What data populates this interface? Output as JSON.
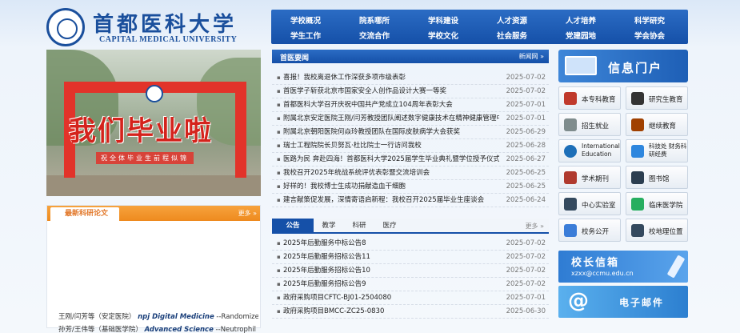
{
  "header": {
    "logo_cn": "首都医科大学",
    "logo_en": "CAPITAL MEDICAL UNIVERSITY"
  },
  "nav": {
    "row1": [
      "学校概况",
      "院系哪所",
      "学科建设",
      "人才资源",
      "人才培养",
      "科学研究"
    ],
    "row2": [
      "学生工作",
      "交流合作",
      "学校文化",
      "社会服务",
      "党建园地",
      "学会协会"
    ]
  },
  "hero": {
    "banner": "我们毕业啦",
    "subtitle": "祝全体毕业生前程似锦"
  },
  "papers": {
    "tab": "最新科研论文",
    "more": "更多 »",
    "items": [
      {
        "authors": "王刚/闫芳等（安定医院）",
        "journal": "npj Digital Medicine",
        "title": " --Randomized"
      },
      {
        "authors": "孙芳/王伟等（基础医学院）",
        "journal": "Advanced Science",
        "title": " --Neutrophil"
      }
    ]
  },
  "news": {
    "title": "首医要闻",
    "more": "新闻网 »",
    "items": [
      {
        "text": "喜报！我校离退休工作深获多项市级表彰",
        "date": "2025-07-02"
      },
      {
        "text": "首医学子斩获北京市国家安全人创作品设计大赛一等奖",
        "date": "2025-07-02"
      },
      {
        "text": "首都医科大学召开庆祝中国共产党成立104周年表彰大会",
        "date": "2025-07-01"
      },
      {
        "text": "附属北京安定医院王刚/闫芳教授团队阐述数字健康技术在精神健康管理中的应",
        "date": "2025-07-01"
      },
      {
        "text": "附属北京朝阳医院何焱玲教授团队在国际皮肤病学大会获奖",
        "date": "2025-06-29"
      },
      {
        "text": "瑞士工程院院长贝努瓦·杜比院士一行访问我校",
        "date": "2025-06-28"
      },
      {
        "text": "医路为民 奔赴四海！首都医科大学2025届学生毕业典礼暨学位授予仪式举行",
        "date": "2025-06-27"
      },
      {
        "text": "我校召开2025年统战系统评优表彰暨交流培训会",
        "date": "2025-06-25"
      },
      {
        "text": "好样的！我校博士生成功捐献造血干细胞",
        "date": "2025-06-25"
      },
      {
        "text": "建言献策促发展，深情寄语启新程：我校召开2025届毕业生座谈会",
        "date": "2025-06-24"
      }
    ]
  },
  "notices": {
    "tabs": [
      "公告",
      "教学",
      "科研",
      "医疗"
    ],
    "active_tab": "公告",
    "more": "更多 »",
    "items": [
      {
        "text": "2025年后勤服务中标公告8",
        "date": "2025-07-02"
      },
      {
        "text": "2025年后勤服务招标公告11",
        "date": "2025-07-02"
      },
      {
        "text": "2025年后勤服务招标公告10",
        "date": "2025-07-02"
      },
      {
        "text": "2025年后勤服务招标公告9",
        "date": "2025-07-02"
      },
      {
        "text": "政府采购项目CFTC-BJ01-2504080",
        "date": "2025-07-01"
      },
      {
        "text": "政府采购项目BMCC-ZC25-0830",
        "date": "2025-06-30"
      }
    ]
  },
  "portal": {
    "label": "信息门户"
  },
  "quick_links": [
    {
      "label": "本专科教育",
      "icon": "book-icon",
      "color": "#c0392b"
    },
    {
      "label": "研究生教育",
      "icon": "graduation-cap-icon",
      "color": "#333333"
    },
    {
      "label": "招生就业",
      "icon": "handshake-icon",
      "color": "#7f8c8d"
    },
    {
      "label": "继续教育",
      "icon": "books-icon",
      "color": "#a04000"
    },
    {
      "label": "International Education",
      "icon": "globe-icon",
      "color": "#1e6fb8"
    },
    {
      "label": "科技处 财务科研经费",
      "icon": "finance-icon",
      "color": "#2e86de"
    },
    {
      "label": "学术期刊",
      "icon": "journal-icon",
      "color": "#b03a2e"
    },
    {
      "label": "图书馆",
      "icon": "library-icon",
      "color": "#2c3e50"
    },
    {
      "label": "中心实验室",
      "icon": "microscope-icon",
      "color": "#34495e"
    },
    {
      "label": "临床医学院",
      "icon": "medical-icon",
      "color": "#27ae60"
    },
    {
      "label": "校务公开",
      "icon": "monitor-icon",
      "color": "#3b7dd8"
    },
    {
      "label": "校地理位置",
      "icon": "map-icon",
      "color": "#34495e"
    }
  ],
  "mailbox": {
    "title": "校长信箱",
    "email": "xzxx@ccmu.edu.cn"
  },
  "email": {
    "symbol": "@",
    "title": "电子邮件"
  }
}
